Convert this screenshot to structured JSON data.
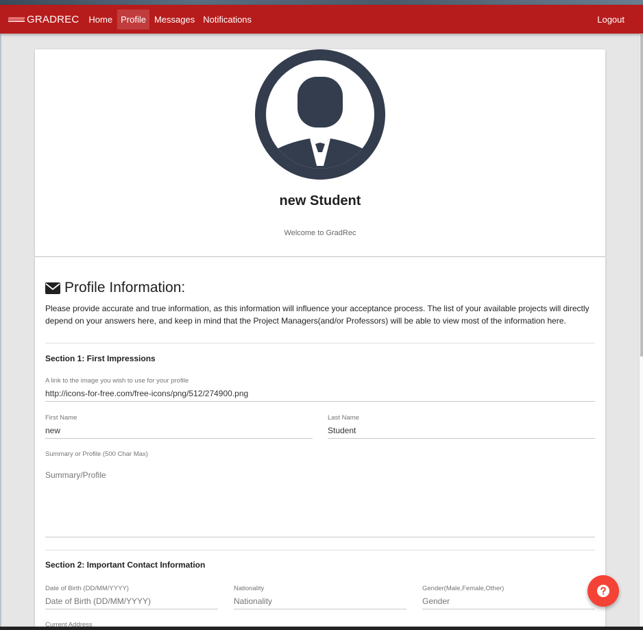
{
  "navbar": {
    "brand": "GRADREC",
    "links": [
      {
        "label": "Home"
      },
      {
        "label": "Profile"
      },
      {
        "label": "Messages"
      },
      {
        "label": "Notifications"
      }
    ],
    "logout": "Logout",
    "color": "#b71c1c"
  },
  "profile_card": {
    "name": "new Student",
    "welcome": "Welcome to GradRec",
    "avatar_color": "#333d4e",
    "avatar_icon": "user-avatar-icon"
  },
  "main": {
    "title": "Profile Information:",
    "title_icon": "envelope-icon",
    "description": "Please provide accurate and true information, as this information will influence your acceptance process. The list of your available projects will directly depend on your answers here, and keep in mind that the Project Managers(and/or Professors) will be able to view most of the information here.",
    "section1": {
      "title": "Section 1: First Impressions",
      "image_link": {
        "label": "A link to the image you wish to use for your profile",
        "value": "http://icons-for-free.com/free-icons/png/512/274900.png"
      },
      "first_name": {
        "label": "First Name",
        "value": "new"
      },
      "last_name": {
        "label": "Last Name",
        "value": "Student"
      },
      "summary": {
        "label": "Summary or Profile (500 Char Max)",
        "placeholder": "Summary/Profile"
      }
    },
    "section2": {
      "title": "Section 2: Important Contact Information",
      "dob": {
        "label": "Date of Birth (DD/MM/YYYY)",
        "placeholder": "Date of Birth (DD/MM/YYYY)"
      },
      "nationality": {
        "label": "Nationality",
        "placeholder": "Nationality"
      },
      "gender": {
        "label": "Gender(Male,Female,Other)",
        "placeholder": "Gender"
      },
      "address": {
        "label": "Current Address"
      }
    }
  },
  "help_button": {
    "icon": "question-circle-icon",
    "color": "#f44336"
  }
}
